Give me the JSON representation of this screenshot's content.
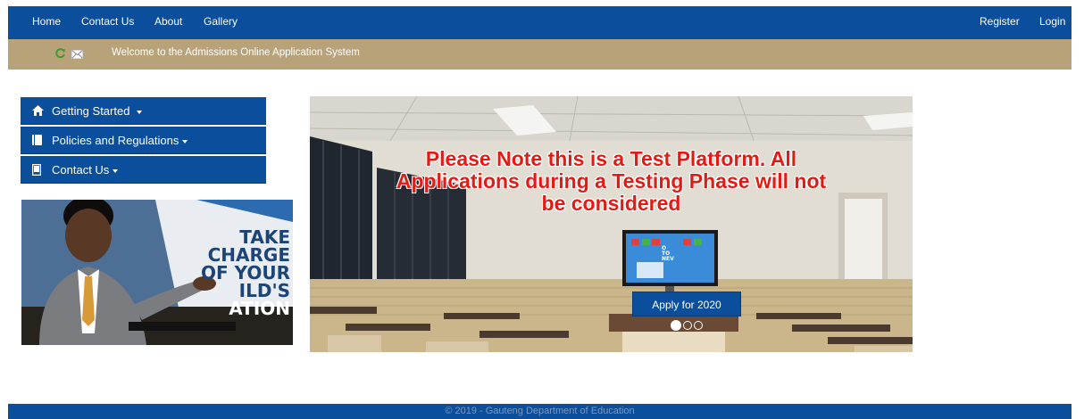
{
  "nav": {
    "home": "Home",
    "contact": "Contact Us",
    "about": "About",
    "gallery": "Gallery",
    "register": "Register",
    "login": "Login"
  },
  "welcome": {
    "message": "Welcome to the Admissions Online Application System",
    "icons": [
      "refresh-icon",
      "mail-icon"
    ]
  },
  "sidebar": {
    "items": [
      {
        "label": "Getting Started",
        "icon": "home-icon"
      },
      {
        "label": "Policies and Regulations",
        "icon": "book-icon"
      },
      {
        "label": "Contact Us",
        "icon": "phone-icon"
      }
    ]
  },
  "promo": {
    "lines": [
      "TAKE",
      "CHARGE",
      "OF YOUR",
      "ILD'S",
      "ATION"
    ]
  },
  "carousel": {
    "notice_lines": [
      "Please Note this is a Test Platform. All",
      "Applications during a Testing Phase will not",
      "be considered"
    ],
    "screen_letters": [
      "O",
      "TO",
      "NEV"
    ],
    "button_label": "Apply for 2020",
    "slides_count": 3,
    "active_slide": 1
  },
  "footer": {
    "text": "© 2019 - Gauteng Department of Education"
  },
  "colors": {
    "primary": "#0a4e9c",
    "welcome_bar": "#b8a27a",
    "notice_red": "#e01c16"
  }
}
